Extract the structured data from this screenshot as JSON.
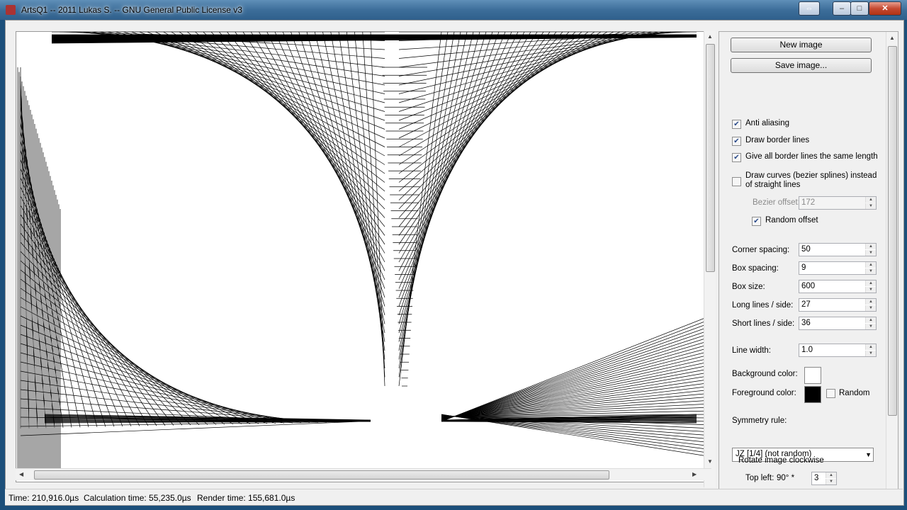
{
  "window": {
    "title": "ArtsQ1 -- 2011 Lukas S. -- GNU General Public License v3"
  },
  "controls": {
    "new_image": "New image",
    "save_image": "Save image...",
    "anti_aliasing": "Anti aliasing",
    "draw_border_lines": "Draw border lines",
    "same_length": "Give all border lines the same length",
    "draw_curves_1": "Draw curves (bezier splines) instead",
    "draw_curves_2": "of straight lines",
    "bezier_offset_label": "Bezier offset:",
    "bezier_offset_value": "172",
    "random_offset": "Random offset",
    "corner_spacing_label": "Corner spacing:",
    "corner_spacing_value": "50",
    "box_spacing_label": "Box spacing:",
    "box_spacing_value": "9",
    "box_size_label": "Box size:",
    "box_size_value": "600",
    "long_lines_label": "Long lines / side:",
    "long_lines_value": "27",
    "short_lines_label": "Short lines / side:",
    "short_lines_value": "36",
    "line_width_label": "Line width:",
    "line_width_value": "1.0",
    "background_color_label": "Background color:",
    "background_color": "#ffffff",
    "foreground_color_label": "Foreground color:",
    "foreground_color": "#000000",
    "random_color": "Random",
    "symmetry_label": "Symmetry rule:",
    "symmetry_value": "JZ [1/4] (not random)",
    "rotate_label": "Rotate image clockwise",
    "top_left_label": "Top left:",
    "top_left_degrees": "90° *",
    "top_left_value": "3"
  },
  "status": {
    "time": "Time: 210,916.0µs",
    "calc": "Calculation time: 55,235.0µs",
    "render": "Render time: 155,681.0µs"
  }
}
